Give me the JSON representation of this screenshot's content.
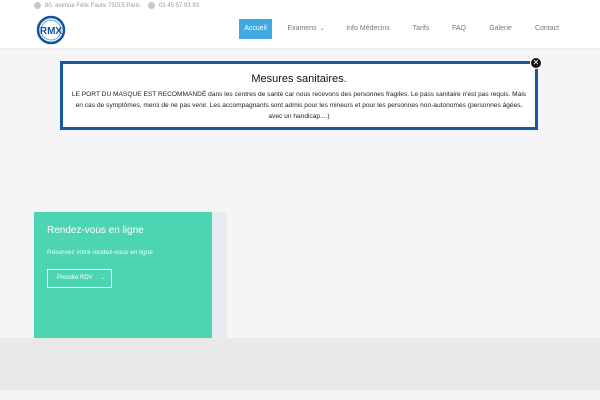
{
  "topbar": {
    "address": "80, avenue Félix Faure 75015 Paris",
    "phone": "01 45 57 93 93"
  },
  "logo": {
    "text": "RMX",
    "color": "#1a4f99"
  },
  "nav": {
    "items": [
      {
        "label": "Accueil",
        "active": true
      },
      {
        "label": "Examens",
        "has_dropdown": true
      },
      {
        "label": "Info Médecins"
      },
      {
        "label": "Tarifs"
      },
      {
        "label": "FAQ"
      },
      {
        "label": "Galerie"
      },
      {
        "label": "Contact"
      }
    ],
    "active_color": "#3fa9e0"
  },
  "notice": {
    "title": "Mesures sanitaires.",
    "body": "LE PORT DU MASQUE EST RECOMMANDÉ dans les centres de santé car nous recevons des personnes fragiles. Le pass sanitaire n'est pas requis. Mais en cas de symptômes, merci de ne pas venir. Les accompagnants sont admis pour les mineurs et pour les personnes non-autonomes (personnes âgées, avec un handicap....)",
    "close_symbol": "✕",
    "border_color": "#1a56a6"
  },
  "rdv": {
    "title": "Rendez-vous en ligne",
    "subtitle": "Réservez votre rendez-vous en ligne",
    "button_label": "Prendre RDV",
    "button_arrow": "→",
    "bg_color": "#4dd4b3"
  },
  "icons": {
    "address": "map-pin-icon",
    "phone": "phone-icon",
    "dropdown": "chevron-down-icon"
  }
}
